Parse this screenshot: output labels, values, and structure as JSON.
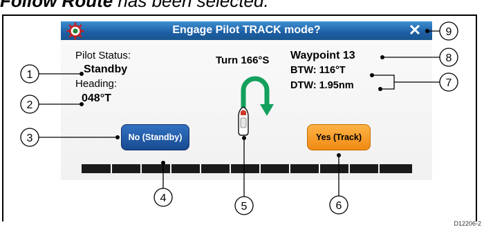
{
  "heading": {
    "bold_part": "Follow Route",
    "rest": " has been selected."
  },
  "dialog": {
    "title": "Engage Pilot TRACK mode?",
    "close_symbol": "✕",
    "pilot_status_label": "Pilot Status:",
    "pilot_status_value": "Standby",
    "heading_label": "Heading:",
    "heading_value": "048°T",
    "turn_text": "Turn 166°S",
    "waypoint": "Waypoint 13",
    "btw": "BTW: 116°T",
    "dtw": "DTW: 1.95nm",
    "no_button": "No (Standby)",
    "yes_button": "Yes (Track)",
    "progress_segments": 11
  },
  "callouts": [
    "1",
    "2",
    "3",
    "4",
    "5",
    "6",
    "7",
    "8",
    "9"
  ],
  "figure_code": "D12206-2",
  "colors": {
    "titlebar": "#1c5ea4",
    "no_button": "#184a90",
    "yes_button": "#f08a12",
    "turn_arrow": "#13a05c"
  },
  "icons": {
    "helm": "helm-wheel-icon",
    "close": "close-icon",
    "boat": "boat-icon",
    "turn_arrow": "u-turn-arrow-icon"
  }
}
